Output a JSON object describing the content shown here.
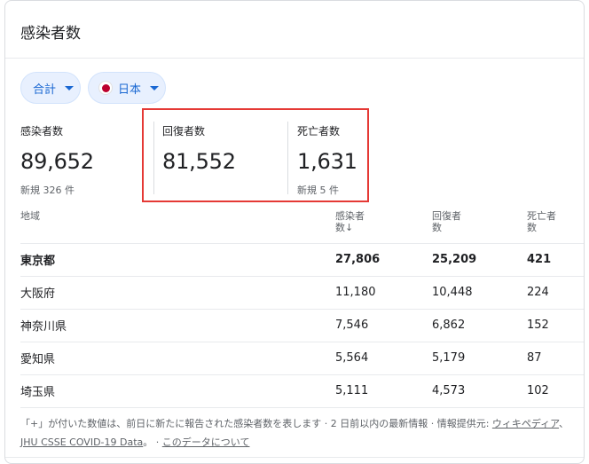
{
  "header": {
    "title": "感染者数"
  },
  "filters": {
    "total_label": "合計",
    "country_label": "日本"
  },
  "stats": {
    "cases": {
      "label": "感染者数",
      "value": "89,652",
      "sub": "新規 326 件"
    },
    "recovered": {
      "label": "回復者数",
      "value": "81,552"
    },
    "deaths": {
      "label": "死亡者数",
      "value": "1,631",
      "sub": "新規 5 件"
    }
  },
  "table": {
    "headers": {
      "region": "地域",
      "cases_line1": "感染者",
      "cases_line2": "数↓",
      "recovered_line1": "回復者",
      "recovered_line2": "数",
      "deaths_line1": "死亡者",
      "deaths_line2": "数"
    },
    "rows": [
      {
        "region": "東京都",
        "cases": "27,806",
        "recovered": "25,209",
        "deaths": "421"
      },
      {
        "region": "大阪府",
        "cases": "11,180",
        "recovered": "10,448",
        "deaths": "224"
      },
      {
        "region": "神奈川県",
        "cases": "7,546",
        "recovered": "6,862",
        "deaths": "152"
      },
      {
        "region": "愛知県",
        "cases": "5,564",
        "recovered": "5,179",
        "deaths": "87"
      },
      {
        "region": "埼玉県",
        "cases": "5,111",
        "recovered": "4,573",
        "deaths": "102"
      }
    ]
  },
  "footer": {
    "note": "「+」が付いた数値は、前日に新たに報告された感染者数を表します · 2 日前以内の最新情報 · 情報提供元: ",
    "link_wiki": "ウィキペディア",
    "sep1": "、",
    "link_jhu": "JHU CSSE COVID-19 Data",
    "sep2": "。 · ",
    "link_about": "このデータについて"
  },
  "colors": {
    "accent": "#1967d2",
    "highlight_box": "#e53935",
    "chip_bg": "#e8f0fe"
  },
  "icons": {
    "dropdown": "caret-down-icon",
    "flag": "japan-flag-icon"
  }
}
